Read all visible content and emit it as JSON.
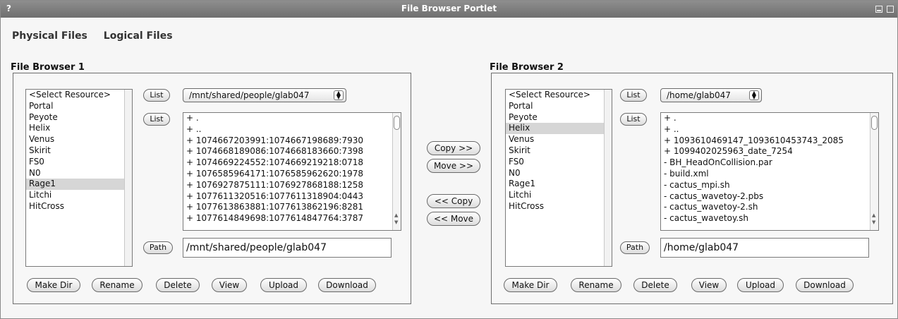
{
  "window": {
    "help_label": "?",
    "title": "File Browser Portlet"
  },
  "tabs": [
    "Physical Files",
    "Logical Files"
  ],
  "middle": {
    "copy_right": "Copy >>",
    "move_right": "Move >>",
    "copy_left": "<< Copy",
    "move_left": "<< Move"
  },
  "browser1": {
    "title": "File Browser 1",
    "resources": [
      "<Select Resource>",
      "Portal",
      "Peyote",
      "Helix",
      "Venus",
      "Skirit",
      "FS0",
      "N0",
      "Rage1",
      "Litchi",
      "HitCross"
    ],
    "selected_resource": "Rage1",
    "list_label": "List",
    "list2_label": "List",
    "dir_select": "/mnt/shared/people/glab047",
    "files": [
      "+ .",
      "+ ..",
      "+ 1074667203991:1074667198689:7930",
      "+ 1074668189086:1074668183660:7398",
      "+ 1074669224552:1074669219218:0718",
      "+ 1076585964171:1076585962620:1978",
      "+ 1076927875111:1076927868188:1258",
      "+ 1077611320516:1077611318904:0443",
      "+ 1077613863881:1077613862196:8281",
      "+ 1077614849698:1077614847764:3787"
    ],
    "path_label": "Path",
    "path_value": "/mnt/shared/people/glab047",
    "actions": [
      "Make Dir",
      "Rename",
      "Delete",
      "View",
      "Upload",
      "Download"
    ]
  },
  "browser2": {
    "title": "File Browser 2",
    "resources": [
      "<Select Resource>",
      "Portal",
      "Peyote",
      "Helix",
      "Venus",
      "Skirit",
      "FS0",
      "N0",
      "Rage1",
      "Litchi",
      "HitCross"
    ],
    "selected_resource": "Helix",
    "list_label": "List",
    "list2_label": "List",
    "dir_select": "/home/glab047",
    "files": [
      "+ .",
      "+ ..",
      "+ 1093610469147_1093610453743_2085",
      "+ 1099402025963_date_7254",
      "- BH_HeadOnCollision.par",
      "- build.xml",
      "- cactus_mpi.sh",
      "- cactus_wavetoy-2.pbs",
      "- cactus_wavetoy-2.sh",
      "- cactus_wavetoy.sh"
    ],
    "path_label": "Path",
    "path_value": "/home/glab047",
    "actions": [
      "Make Dir",
      "Rename",
      "Delete",
      "View",
      "Upload",
      "Download"
    ]
  }
}
